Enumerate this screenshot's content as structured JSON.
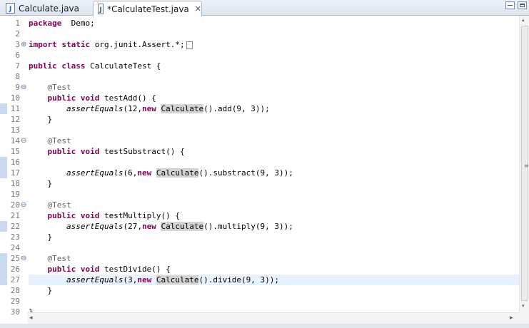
{
  "tabs": [
    {
      "icon": "java-file-icon",
      "label": "Calculate.java",
      "active": false
    },
    {
      "icon": "java-file-icon",
      "label": "*CalculateTest.java",
      "active": true,
      "close": "✕"
    }
  ],
  "tab_icon_glyph": "J",
  "editor": {
    "current_line": 27,
    "colors": {
      "keyword": "#7f0055",
      "annotation": "#646464",
      "line_number": "#787878",
      "current_line_bg": "#e8f2fe",
      "occurrence_highlight": "#d4d4d4",
      "change_marker": "#c9d9f0"
    },
    "lines": [
      {
        "num": "1",
        "segs": [
          [
            "kw",
            "package"
          ],
          [
            "",
            "  Demo;"
          ]
        ]
      },
      {
        "num": "2",
        "segs": []
      },
      {
        "num": "3",
        "fold": "⊕",
        "segs": [
          [
            "kw",
            "import"
          ],
          [
            "",
            ""
          ],
          [
            "kw",
            " static"
          ],
          [
            "",
            " org.junit.Assert.*;"
          ]
        ],
        "folded_box": true
      },
      {
        "num": "6",
        "segs": []
      },
      {
        "num": "7",
        "segs": [
          [
            "kw",
            "public"
          ],
          [
            "",
            " "
          ],
          [
            "kw",
            "class"
          ],
          [
            "",
            " CalculateTest {"
          ]
        ]
      },
      {
        "num": "8",
        "segs": []
      },
      {
        "num": "9",
        "fold": "⊖",
        "segs": [
          [
            "",
            "    "
          ],
          [
            "ann",
            "@Test"
          ]
        ]
      },
      {
        "num": "10",
        "segs": [
          [
            "",
            "    "
          ],
          [
            "kw",
            "public"
          ],
          [
            "",
            " "
          ],
          [
            "kw",
            "void"
          ],
          [
            "",
            " testAdd() {"
          ]
        ]
      },
      {
        "num": "11",
        "marker": true,
        "segs": [
          [
            "",
            "        "
          ],
          [
            "it",
            "assertEquals"
          ],
          [
            "",
            "(12,"
          ],
          [
            "kw",
            "new"
          ],
          [
            "",
            " "
          ],
          [
            "hl",
            "Calculate"
          ],
          [
            "",
            "().add(9, 3));"
          ]
        ]
      },
      {
        "num": "12",
        "segs": [
          [
            "",
            "    }"
          ]
        ]
      },
      {
        "num": "13",
        "segs": []
      },
      {
        "num": "14",
        "fold": "⊖",
        "segs": [
          [
            "",
            "    "
          ],
          [
            "ann",
            "@Test"
          ]
        ]
      },
      {
        "num": "15",
        "segs": [
          [
            "",
            "    "
          ],
          [
            "kw",
            "public"
          ],
          [
            "",
            " "
          ],
          [
            "kw",
            "void"
          ],
          [
            "",
            " testSubstract() {"
          ]
        ]
      },
      {
        "num": "16",
        "marker": true,
        "segs": []
      },
      {
        "num": "17",
        "marker": true,
        "segs": [
          [
            "",
            "        "
          ],
          [
            "it",
            "assertEquals"
          ],
          [
            "",
            "(6,"
          ],
          [
            "kw",
            "new"
          ],
          [
            "",
            " "
          ],
          [
            "hl",
            "Calculate"
          ],
          [
            "",
            "().substract(9, 3));"
          ]
        ]
      },
      {
        "num": "18",
        "segs": [
          [
            "",
            "    }"
          ]
        ]
      },
      {
        "num": "19",
        "segs": []
      },
      {
        "num": "20",
        "fold": "⊖",
        "segs": [
          [
            "",
            "    "
          ],
          [
            "ann",
            "@Test"
          ]
        ]
      },
      {
        "num": "21",
        "segs": [
          [
            "",
            "    "
          ],
          [
            "kw",
            "public"
          ],
          [
            "",
            " "
          ],
          [
            "kw",
            "void"
          ],
          [
            "",
            " testMultiply() {"
          ]
        ]
      },
      {
        "num": "22",
        "marker": true,
        "segs": [
          [
            "",
            "        "
          ],
          [
            "it",
            "assertEquals"
          ],
          [
            "",
            "(27,"
          ],
          [
            "kw",
            "new"
          ],
          [
            "",
            " "
          ],
          [
            "hl",
            "Calculate"
          ],
          [
            "",
            "().multiply(9, 3));"
          ]
        ]
      },
      {
        "num": "23",
        "segs": [
          [
            "",
            "    }"
          ]
        ]
      },
      {
        "num": "24",
        "segs": []
      },
      {
        "num": "25",
        "fold": "⊖",
        "marker": true,
        "segs": [
          [
            "",
            "    "
          ],
          [
            "ann",
            "@Test"
          ]
        ]
      },
      {
        "num": "26",
        "marker": true,
        "segs": [
          [
            "",
            "    "
          ],
          [
            "kw",
            "public"
          ],
          [
            "",
            " "
          ],
          [
            "kw",
            "void"
          ],
          [
            "",
            " testDivide() {"
          ]
        ]
      },
      {
        "num": "27",
        "marker": true,
        "segs": [
          [
            "",
            "        "
          ],
          [
            "it",
            "assertEquals"
          ],
          [
            "",
            "(3,"
          ],
          [
            "kw",
            "new"
          ],
          [
            "",
            " "
          ],
          [
            "hl",
            "Calculate"
          ],
          [
            "",
            "().divide(9, 3));"
          ]
        ]
      },
      {
        "num": "28",
        "segs": [
          [
            "",
            "    }"
          ]
        ]
      },
      {
        "num": "29",
        "segs": []
      },
      {
        "num": "30",
        "segs": [
          [
            "",
            "}"
          ]
        ]
      }
    ]
  },
  "scrollbars": {
    "left_arrow": "◂",
    "right_arrow": "▸",
    "up_arrow": "▴",
    "down_arrow": "▾",
    "grip": "≡"
  }
}
